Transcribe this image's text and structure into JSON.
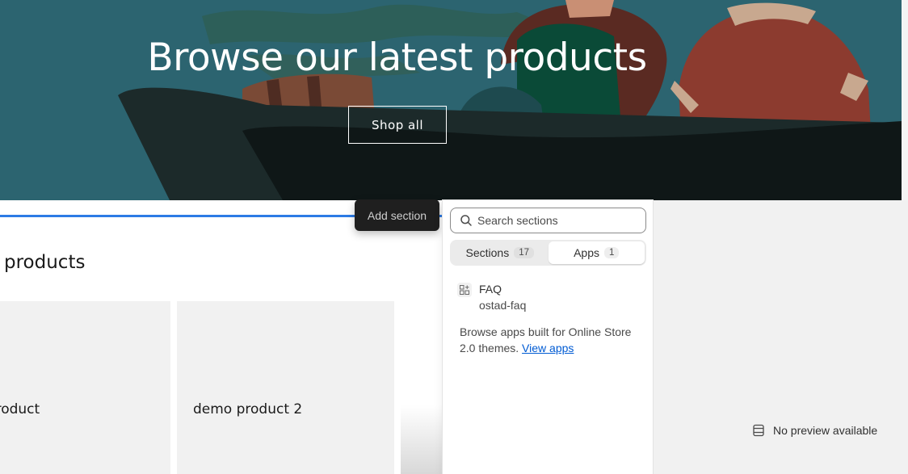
{
  "hero": {
    "title": "Browse our latest products",
    "button_label": "Shop all"
  },
  "featured": {
    "title": "red products",
    "cards": [
      {
        "title": "o product"
      },
      {
        "title": "demo product 2"
      }
    ]
  },
  "tooltip": {
    "label": "Add section"
  },
  "panel": {
    "search_placeholder": "Search sections",
    "tabs": [
      {
        "label": "Sections",
        "count": "17"
      },
      {
        "label": "Apps",
        "count": "1"
      }
    ],
    "active_tab": "Apps",
    "apps": [
      {
        "name": "FAQ",
        "handle": "ostad-faq",
        "icon": "app-block-icon"
      }
    ],
    "browse_text": "Browse apps built for Online Store 2.0 themes.",
    "browse_link": "View apps"
  },
  "preview": {
    "label": "No preview available",
    "icon": "preview-icon"
  },
  "colors": {
    "hero_bg": "#2c6470",
    "accent_line": "#2c7be5",
    "link": "#005bd3"
  }
}
